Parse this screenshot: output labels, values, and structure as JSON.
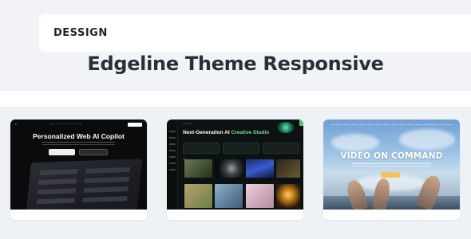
{
  "header": {
    "logo_text": "DESSIGN"
  },
  "page": {
    "title": "Edgeline Theme Responsive"
  },
  "cards": [
    {
      "headline": "Personalized Web AI Copilot"
    },
    {
      "headline_prefix": "Next-Generation AI ",
      "headline_highlight": "Creative Studio"
    },
    {
      "headline": "VIDEO ON COMMAND"
    }
  ],
  "colors": {
    "page_background": "#eef1f5",
    "header_background": "#ffffff",
    "title_color": "#2a2f37",
    "accent_green": "#79d8a4",
    "accent_yellow": "#f3c35d"
  }
}
